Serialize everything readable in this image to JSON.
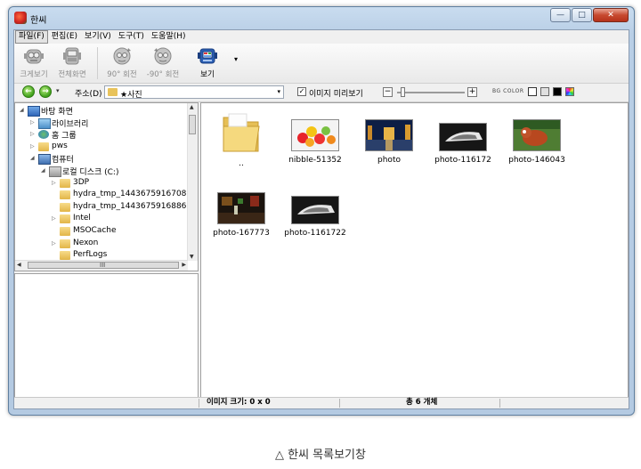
{
  "window": {
    "title": "한씨"
  },
  "window_buttons": {
    "minimize": "—",
    "maximize": "□",
    "close": "✕"
  },
  "menu": [
    "파일(F)",
    "편집(E)",
    "보기(V)",
    "도구(T)",
    "도움말(H)"
  ],
  "toolbar": {
    "items": [
      {
        "label": "크게보기",
        "icon": "magnify-robot-icon",
        "enabled": false
      },
      {
        "label": "전체화면",
        "icon": "fullscreen-robot-icon",
        "enabled": false
      },
      {
        "label": "90° 회전",
        "icon": "rotate-cw-robot-icon",
        "enabled": false
      },
      {
        "label": "-90° 회전",
        "icon": "rotate-ccw-robot-icon",
        "enabled": false
      },
      {
        "label": "보기",
        "icon": "view-robot-icon",
        "enabled": true
      }
    ],
    "more_arrow": "▾"
  },
  "addressbar": {
    "back": "←",
    "forward": "→",
    "dropdown": "▾",
    "label": "주소(D)",
    "path": "★사진",
    "path_dropdown": "▾",
    "preview_checked": true,
    "preview_check_mark": "✓",
    "preview_label": "이미지 미리보기",
    "zoom_out": "−",
    "zoom_in": "+",
    "zoom_level": 0.05,
    "bg_color_label": "BG COLOR",
    "bg_colors": [
      "#ffffff",
      "#e0e0e0",
      "#000000",
      "multicolor"
    ]
  },
  "tree": [
    {
      "label": "바탕 화면",
      "level": 0,
      "arrow": "◢",
      "icon": "desktop-icon"
    },
    {
      "label": "라이브러리",
      "level": 1,
      "arrow": "▷",
      "icon": "library-icon"
    },
    {
      "label": "홈 그룹",
      "level": 1,
      "arrow": "▷",
      "icon": "homegroup-icon"
    },
    {
      "label": "pws",
      "level": 1,
      "arrow": "▷",
      "icon": "user-folder-icon"
    },
    {
      "label": "컴퓨터",
      "level": 1,
      "arrow": "◢",
      "icon": "computer-icon"
    },
    {
      "label": "로컬 디스크 (C:)",
      "level": 2,
      "arrow": "◢",
      "icon": "disk-icon"
    },
    {
      "label": "3DP",
      "level": 3,
      "arrow": "▷",
      "icon": "folder-icon"
    },
    {
      "label": "hydra_tmp_1443675916708",
      "level": 3,
      "arrow": "",
      "icon": "folder-icon"
    },
    {
      "label": "hydra_tmp_1443675916886",
      "level": 3,
      "arrow": "",
      "icon": "folder-icon"
    },
    {
      "label": "Intel",
      "level": 3,
      "arrow": "▷",
      "icon": "folder-icon"
    },
    {
      "label": "MSOCache",
      "level": 3,
      "arrow": "",
      "icon": "folder-icon"
    },
    {
      "label": "Nexon",
      "level": 3,
      "arrow": "▷",
      "icon": "folder-icon"
    },
    {
      "label": "PerfLogs",
      "level": 3,
      "arrow": "",
      "icon": "folder-icon"
    }
  ],
  "scroll": {
    "up": "▲",
    "down": "▼",
    "left": "◀",
    "right": "▶",
    "grip": "III"
  },
  "files": [
    {
      "name": "..",
      "kind": "parent-folder"
    },
    {
      "name": "nibble-51352",
      "kind": "image"
    },
    {
      "name": "photo",
      "kind": "image"
    },
    {
      "name": "photo-116172",
      "kind": "image"
    },
    {
      "name": "photo-146043",
      "kind": "image"
    },
    {
      "name": "photo-167773",
      "kind": "image"
    },
    {
      "name": "photo-1161722",
      "kind": "image"
    }
  ],
  "status": {
    "image_size": "이미지 크기: 0 x 0",
    "total": "총 6 개체"
  },
  "caption": "△ 한씨 목록보기창",
  "colors": {
    "accent": "#3f9f1a",
    "title_bar": "#b9cfe6",
    "close_button": "#c74a2f"
  }
}
